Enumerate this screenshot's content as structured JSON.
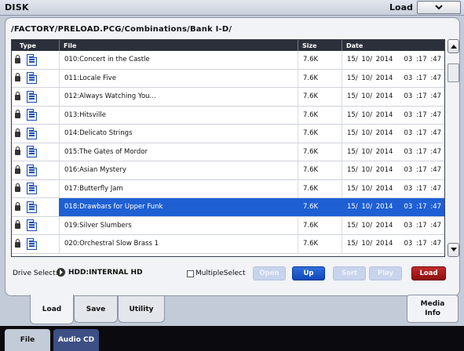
{
  "window": {
    "title": "DISK",
    "menu_label": "Load"
  },
  "path": "/FACTORY/PRELOAD.PCG/Combinations/Bank I-D/",
  "table": {
    "headers": {
      "type": "Type",
      "file": "File",
      "size": "Size",
      "date": "Date"
    },
    "rows": [
      {
        "file": "010:Concert in the Castle",
        "size": "7.6K",
        "date": "15/ 10/ 2014   03 :17 :47",
        "selected": false
      },
      {
        "file": "011:Locale Five",
        "size": "7.6K",
        "date": "15/ 10/ 2014   03 :17 :47",
        "selected": false
      },
      {
        "file": "012:Always Watching You...",
        "size": "7.6K",
        "date": "15/ 10/ 2014   03 :17 :47",
        "selected": false
      },
      {
        "file": "013:Hitsville",
        "size": "7.6K",
        "date": "15/ 10/ 2014   03 :17 :47",
        "selected": false
      },
      {
        "file": "014:Delicato Strings",
        "size": "7.6K",
        "date": "15/ 10/ 2014   03 :17 :47",
        "selected": false
      },
      {
        "file": "015:The Gates of Mordor",
        "size": "7.6K",
        "date": "15/ 10/ 2014   03 :17 :47",
        "selected": false
      },
      {
        "file": "016:Asian Mystery",
        "size": "7.6K",
        "date": "15/ 10/ 2014   03 :17 :47",
        "selected": false
      },
      {
        "file": "017:Butterfly Jam",
        "size": "7.6K",
        "date": "15/ 10/ 2014   03 :17 :47",
        "selected": false
      },
      {
        "file": "018:Drawbars for Upper Funk",
        "size": "7.6K",
        "date": "15/ 10/ 2014   03 :17 :47",
        "selected": true
      },
      {
        "file": "019:Silver Slumbers",
        "size": "7.6K",
        "date": "15/ 10/ 2014   03 :17 :47",
        "selected": false
      },
      {
        "file": "020:Orchestral Slow Brass 1",
        "size": "7.6K",
        "date": "15/ 10/ 2014   03 :17 :47",
        "selected": false
      }
    ]
  },
  "drive": {
    "label": "Drive Select:",
    "value": "HDD:INTERNAL HD"
  },
  "multiple_select_label": "MultipleSelect",
  "buttons": {
    "open": "Open",
    "up": "Up",
    "sort": "Sort",
    "play": "Play",
    "load": "Load"
  },
  "tabs": {
    "load": "Load",
    "save": "Save",
    "utility": "Utility",
    "media_info": "Media\nInfo"
  },
  "bottom_tabs": {
    "file": "File",
    "audio_cd": "Audio CD"
  },
  "colors": {
    "selection": "#1e60d4",
    "load_button": "#a81c1c",
    "up_button": "#1e5ccc"
  }
}
